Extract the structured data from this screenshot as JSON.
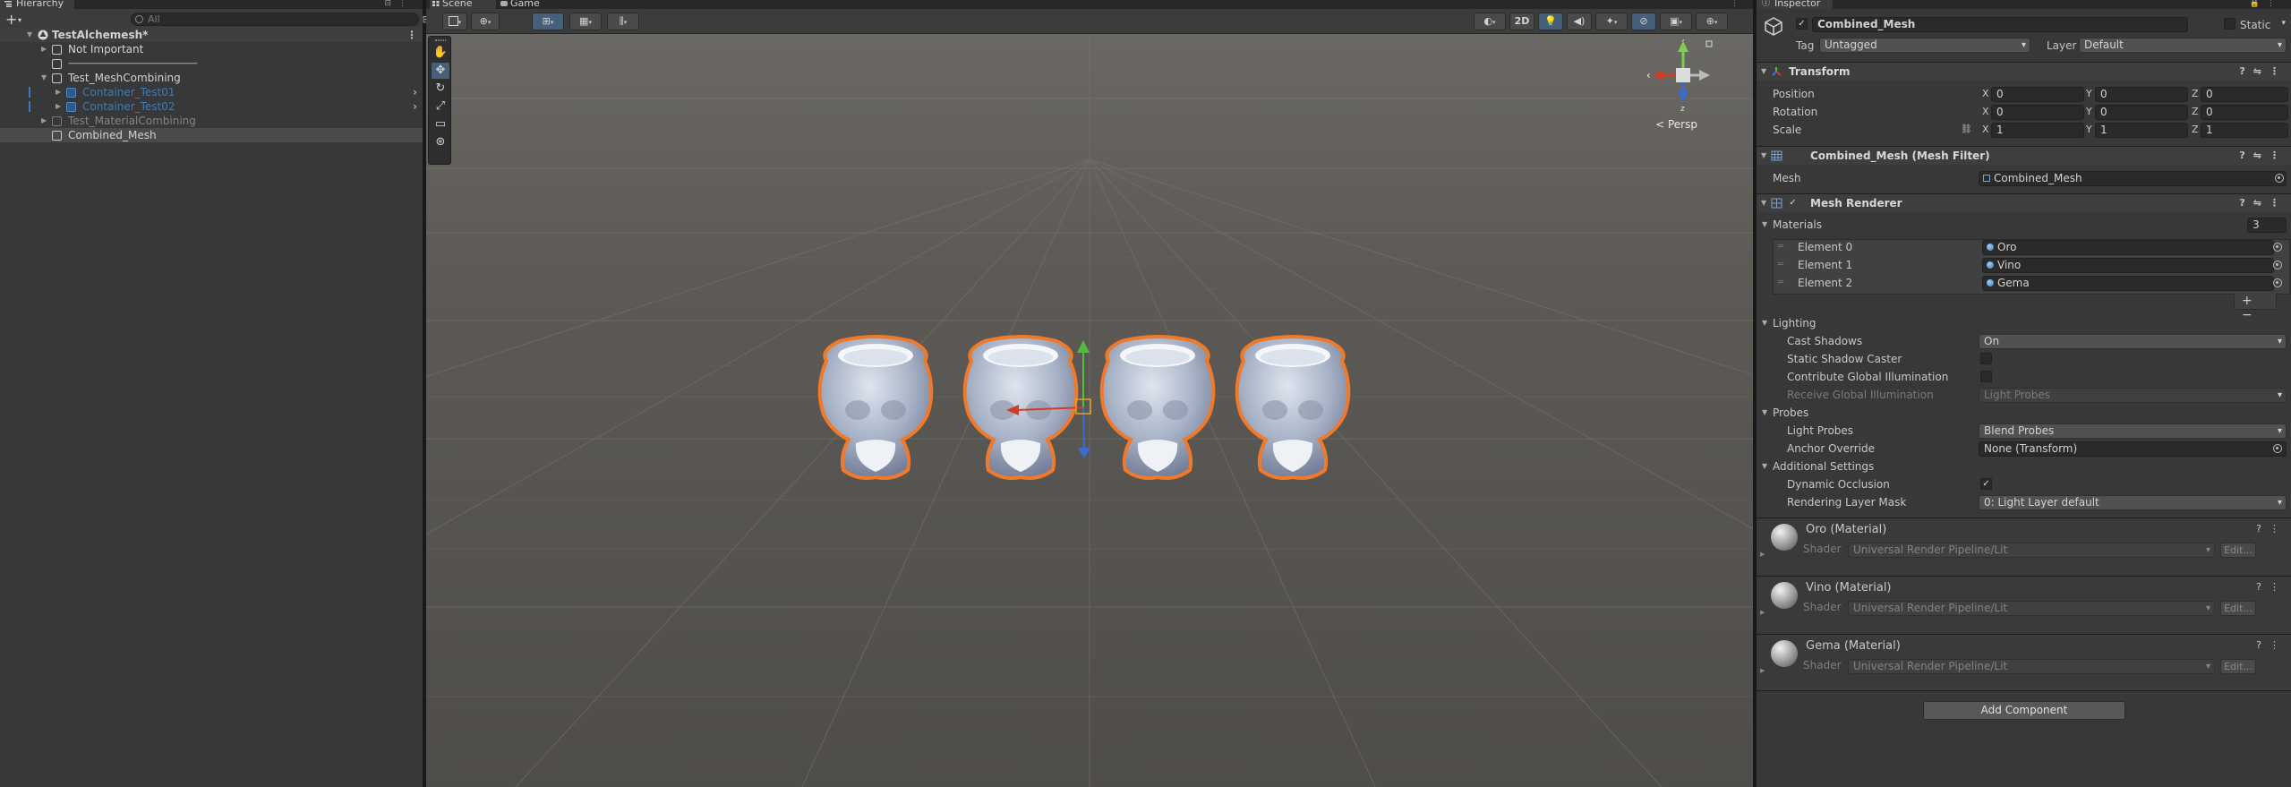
{
  "hierarchy": {
    "tab_label": "Hierarchy",
    "search_placeholder": "All",
    "rows": [
      {
        "label": "TestAlchemesh*"
      },
      {
        "label": "Not Important"
      },
      {
        "label": "----------------------------------------------------------------"
      },
      {
        "label": "Test_MeshCombining"
      },
      {
        "label": "Container_Test01"
      },
      {
        "label": "Container_Test02"
      },
      {
        "label": "Test_MaterialCombining"
      },
      {
        "label": "Combined_Mesh"
      }
    ]
  },
  "scene": {
    "tabs": [
      {
        "label": "Scene"
      },
      {
        "label": "Game"
      }
    ],
    "toggle_2d": "2D",
    "camera_label": "< Persp",
    "axes": {
      "x": "x",
      "y": "y",
      "z": "z"
    }
  },
  "inspector": {
    "tab_label": "Inspector",
    "object_name": "Combined_Mesh",
    "static_label": "Static",
    "tag_label": "Tag",
    "tag_value": "Untagged",
    "layer_label": "Layer",
    "layer_value": "Default",
    "transform": {
      "title": "Transform",
      "rows": [
        {
          "label": "Position",
          "x": "0",
          "y": "0",
          "z": "0"
        },
        {
          "label": "Rotation",
          "x": "0",
          "y": "0",
          "z": "0"
        },
        {
          "label": "Scale",
          "x": "1",
          "y": "1",
          "z": "1"
        }
      ],
      "axis_x": "X",
      "axis_y": "Y",
      "axis_z": "Z"
    },
    "mesh_filter": {
      "title": "Combined_Mesh (Mesh Filter)",
      "mesh_label": "Mesh",
      "mesh_value": "Combined_Mesh"
    },
    "mesh_renderer": {
      "title": "Mesh Renderer",
      "materials_label": "Materials",
      "materials_count": "3",
      "elements": [
        {
          "label": "Element 0",
          "value": "Oro"
        },
        {
          "label": "Element 1",
          "value": "Vino"
        },
        {
          "label": "Element 2",
          "value": "Gema"
        }
      ],
      "lighting_label": "Lighting",
      "cast_shadows_label": "Cast Shadows",
      "cast_shadows_value": "On",
      "static_shadow_label": "Static Shadow Caster",
      "contribute_gi_label": "Contribute Global Illumination",
      "receive_gi_label": "Receive Global Illumination",
      "receive_gi_value": "Light Probes",
      "probes_label": "Probes",
      "light_probes_label": "Light Probes",
      "light_probes_value": "Blend Probes",
      "anchor_label": "Anchor Override",
      "anchor_value": "None (Transform)",
      "additional_label": "Additional Settings",
      "dynamic_occlusion_label": "Dynamic Occlusion",
      "rendering_layer_label": "Rendering Layer Mask",
      "rendering_layer_value": "0: Light Layer default"
    },
    "materials": [
      {
        "title": "Oro (Material)",
        "shader_label": "Shader",
        "shader": "Universal Render Pipeline/Lit",
        "edit": "Edit..."
      },
      {
        "title": "Vino (Material)",
        "shader_label": "Shader",
        "shader": "Universal Render Pipeline/Lit",
        "edit": "Edit..."
      },
      {
        "title": "Gema (Material)",
        "shader_label": "Shader",
        "shader": "Universal Render Pipeline/Lit",
        "edit": "Edit..."
      }
    ],
    "add_component": "Add Component"
  },
  "colors": {
    "selection_outline": "#f07a2a",
    "prefab_text": "#3d7bb8",
    "active_button": "#46607c",
    "scene_bg": "#5a5753"
  }
}
